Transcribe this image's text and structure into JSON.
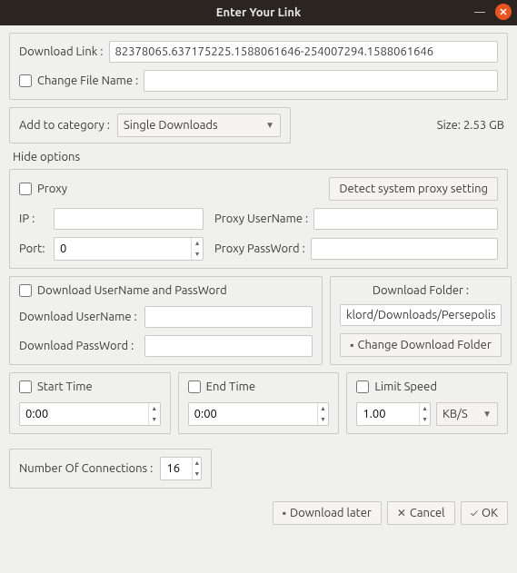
{
  "title": "Enter Your Link",
  "link": {
    "label": "Download Link :",
    "value": "82378065.637175225.1588061646-254007294.1588061646",
    "change_name_label": "Change File Name :",
    "change_name_checked": false,
    "name_value": ""
  },
  "category": {
    "label": "Add to category :",
    "value": "Single Downloads",
    "size_label": "Size: 2.53 GB"
  },
  "options_label": "Hide options",
  "proxy": {
    "label": "Proxy",
    "checked": false,
    "detect_btn": "Detect system proxy setting",
    "ip_label": "IP :",
    "ip_value": "",
    "user_label": "Proxy UserName :",
    "user_value": "",
    "port_label": "Port:",
    "port_value": "0",
    "pass_label": "Proxy PassWord :",
    "pass_value": ""
  },
  "auth": {
    "label": "Download UserName and PassWord",
    "checked": false,
    "user_label": "Download UserName :",
    "user_value": "",
    "pass_label": "Download PassWord :",
    "pass_value": ""
  },
  "folder": {
    "header": "Download Folder :",
    "path": "klord/Downloads/Persepolis",
    "change_btn": "Change Download Folder"
  },
  "start": {
    "label": "Start Time",
    "checked": false,
    "value": "0:00"
  },
  "end": {
    "label": "End Time",
    "checked": false,
    "value": "0:00"
  },
  "limit": {
    "label": "Limit Speed",
    "checked": false,
    "value": "1.00",
    "unit": "KB/S"
  },
  "connections": {
    "label": "Number Of Connections :",
    "value": "16"
  },
  "buttons": {
    "later": "Download later",
    "cancel": "Cancel",
    "ok": "OK"
  }
}
